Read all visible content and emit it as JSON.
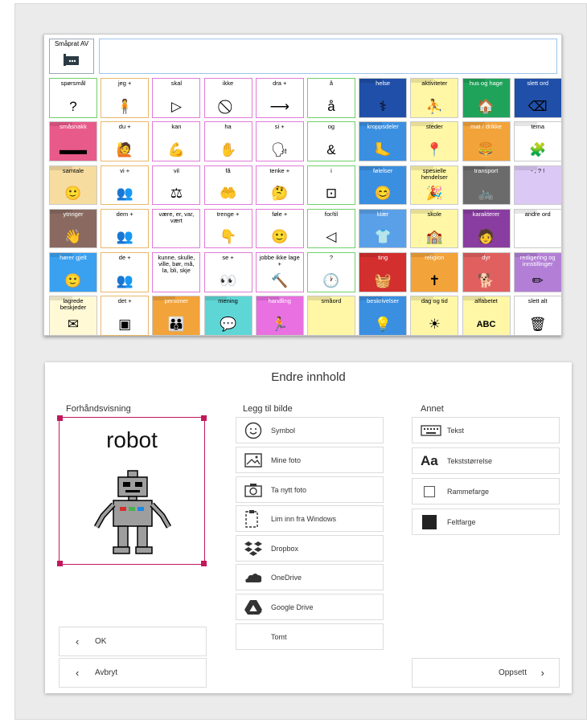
{
  "top_control": {
    "label": "Småprat AV",
    "icon": "speech-bubble-icon"
  },
  "message_bar": {
    "text": ""
  },
  "grid": [
    [
      {
        "label": "spørsmål",
        "glyph": "?",
        "bg": "#ffffff",
        "style": "gr",
        "folder": false
      },
      {
        "label": "jeg +",
        "glyph": "🧍",
        "bg": "#ffffff",
        "style": "yw",
        "folder": false
      },
      {
        "label": "skal",
        "glyph": "▷",
        "bg": "#ffffff",
        "style": "vb",
        "folder": false
      },
      {
        "label": "ikke",
        "glyph": "⃠",
        "bg": "#ffffff",
        "style": "vb",
        "folder": false
      },
      {
        "label": "dra +",
        "glyph": "⟶",
        "bg": "#ffffff",
        "style": "vb",
        "folder": false
      },
      {
        "label": "å",
        "glyph": "å",
        "bg": "#ffffff",
        "style": "gr",
        "folder": false
      },
      {
        "label": "helse",
        "glyph": "⚕",
        "bg": "#1f4fa8",
        "style": "",
        "folder": true
      },
      {
        "label": "aktiviteter",
        "glyph": "⛹",
        "bg": "#fff7a6",
        "style": "",
        "folder": true
      },
      {
        "label": "hus og hage",
        "glyph": "🏠",
        "bg": "#1fa35a",
        "style": "",
        "folder": true
      },
      {
        "label": "slett ord",
        "glyph": "⌫",
        "bg": "#1f4fa8",
        "style": "",
        "folder": false
      }
    ],
    [
      {
        "label": "småsnakk",
        "glyph": "▬▬",
        "bg": "#e85a8a",
        "style": "",
        "folder": true
      },
      {
        "label": "du +",
        "glyph": "🙋",
        "bg": "#ffffff",
        "style": "yw",
        "folder": false
      },
      {
        "label": "kan",
        "glyph": "💪",
        "bg": "#ffffff",
        "style": "vb",
        "folder": false
      },
      {
        "label": "ha",
        "glyph": "✋",
        "bg": "#ffffff",
        "style": "vb",
        "folder": false
      },
      {
        "label": "si +",
        "glyph": "🗣",
        "bg": "#ffffff",
        "style": "vb",
        "folder": false
      },
      {
        "label": "og",
        "glyph": "&",
        "bg": "#ffffff",
        "style": "gr",
        "folder": false
      },
      {
        "label": "kroppsdeler",
        "glyph": "🦶",
        "bg": "#3b8fe0",
        "style": "",
        "folder": true
      },
      {
        "label": "steder",
        "glyph": "📍",
        "bg": "#fff7a6",
        "style": "",
        "folder": true
      },
      {
        "label": "mat / drikke",
        "glyph": "🍔",
        "bg": "#f2a33a",
        "style": "",
        "folder": true
      },
      {
        "label": "tema",
        "glyph": "🧩",
        "bg": "#ffffff",
        "style": "",
        "folder": true
      }
    ],
    [
      {
        "label": "samtale",
        "glyph": "🙂",
        "bg": "#f7dca0",
        "style": "",
        "folder": true
      },
      {
        "label": "vi +",
        "glyph": "👥",
        "bg": "#ffffff",
        "style": "yw",
        "folder": false
      },
      {
        "label": "vil",
        "glyph": "⚖",
        "bg": "#ffffff",
        "style": "vb",
        "folder": false
      },
      {
        "label": "få",
        "glyph": "🤲",
        "bg": "#ffffff",
        "style": "vb",
        "folder": false
      },
      {
        "label": "tenke +",
        "glyph": "🤔",
        "bg": "#ffffff",
        "style": "vb",
        "folder": false
      },
      {
        "label": "i",
        "glyph": "⊡",
        "bg": "#ffffff",
        "style": "gr",
        "folder": false
      },
      {
        "label": "følelser",
        "glyph": "😊",
        "bg": "#3b8fe0",
        "style": "",
        "folder": true
      },
      {
        "label": "spesielle hendelser",
        "glyph": "🎉",
        "bg": "#fff7a6",
        "style": "",
        "folder": true
      },
      {
        "label": "transport",
        "glyph": "🚲",
        "bg": "#6b6b6b",
        "style": "",
        "folder": true
      },
      {
        "label": "- , ? !",
        "glyph": "",
        "bg": "#dcc8f5",
        "style": "",
        "folder": true
      }
    ],
    [
      {
        "label": "ytringer",
        "glyph": "👋",
        "bg": "#8a6a60",
        "style": "",
        "folder": true
      },
      {
        "label": "dem +",
        "glyph": "👥",
        "bg": "#ffffff",
        "style": "yw",
        "folder": false
      },
      {
        "label": "være, er, var, vært",
        "glyph": "",
        "bg": "#ffffff",
        "style": "vb",
        "folder": false
      },
      {
        "label": "trenge +",
        "glyph": "👇",
        "bg": "#ffffff",
        "style": "vb",
        "folder": false
      },
      {
        "label": "føle +",
        "glyph": "🙂",
        "bg": "#ffffff",
        "style": "vb",
        "folder": false
      },
      {
        "label": "for/til",
        "glyph": "◁",
        "bg": "#ffffff",
        "style": "gr",
        "folder": false
      },
      {
        "label": "klær",
        "glyph": "👕",
        "bg": "#5aa0e8",
        "style": "",
        "folder": true
      },
      {
        "label": "skole",
        "glyph": "🏫",
        "bg": "#fff7a6",
        "style": "",
        "folder": true
      },
      {
        "label": "karakterer",
        "glyph": "🧑",
        "bg": "#8a3da0",
        "style": "",
        "folder": true
      },
      {
        "label": "andre ord",
        "glyph": "",
        "bg": "#ffffff",
        "style": "",
        "folder": true
      }
    ],
    [
      {
        "label": "hører gjelt",
        "glyph": "🙂",
        "bg": "#3aa0f0",
        "style": "",
        "folder": true
      },
      {
        "label": "de +",
        "glyph": "👥",
        "bg": "#ffffff",
        "style": "yw",
        "folder": false
      },
      {
        "label": "kunne, skulle, ville, bør, må, la, bli, skje",
        "glyph": "",
        "bg": "#ffffff",
        "style": "vb",
        "folder": false
      },
      {
        "label": "se +",
        "glyph": "👀",
        "bg": "#ffffff",
        "style": "vb",
        "folder": false
      },
      {
        "label": "jobbe ikke lage +",
        "glyph": "🔨",
        "bg": "#ffffff",
        "style": "vb",
        "folder": false
      },
      {
        "label": "?",
        "glyph": "🕐",
        "bg": "#ffffff",
        "style": "gr",
        "folder": false
      },
      {
        "label": "ting",
        "glyph": "🧺",
        "bg": "#d32f2f",
        "style": "",
        "folder": true
      },
      {
        "label": "religion",
        "glyph": "✝",
        "bg": "#f2a33a",
        "style": "",
        "folder": true
      },
      {
        "label": "dyr",
        "glyph": "🐕",
        "bg": "#e06060",
        "style": "",
        "folder": true
      },
      {
        "label": "redigering og innstillinger",
        "glyph": "✏",
        "bg": "#b37fd6",
        "style": "",
        "folder": true
      }
    ],
    [
      {
        "label": "lagrede beskjeder",
        "glyph": "✉",
        "bg": "#fff9d6",
        "style": "",
        "folder": true
      },
      {
        "label": "det +",
        "glyph": "▣",
        "bg": "#ffffff",
        "style": "yw",
        "folder": false
      },
      {
        "label": "personer",
        "glyph": "👪",
        "bg": "#f2a33a",
        "style": "",
        "folder": true
      },
      {
        "label": "mening",
        "glyph": "💬",
        "bg": "#5fd6d6",
        "style": "",
        "folder": true
      },
      {
        "label": "handling",
        "glyph": "🏃",
        "bg": "#e870e0",
        "style": "",
        "folder": true
      },
      {
        "label": "småord",
        "glyph": "",
        "bg": "#fff7a6",
        "style": "",
        "folder": true
      },
      {
        "label": "beskrivelser",
        "glyph": "💡",
        "bg": "#3b8fe0",
        "style": "",
        "folder": true
      },
      {
        "label": "dag og tid",
        "glyph": "☀",
        "bg": "#fff7a6",
        "style": "",
        "folder": true
      },
      {
        "label": "alfabetet",
        "glyph": "ABC",
        "bg": "#fff7a6",
        "style": "",
        "folder": true
      },
      {
        "label": "slett alt",
        "glyph": "🗑",
        "bg": "#ffffff",
        "style": "",
        "folder": false
      }
    ]
  ],
  "panel": {
    "title": "Endre innhold",
    "preview_heading": "Forhåndsvisning",
    "preview_word": "robot",
    "image_heading": "Legg til bilde",
    "other_heading": "Annet",
    "image_buttons": [
      "Symbol",
      "Mine foto",
      "Ta nytt foto",
      "Lim inn fra Windows",
      "Dropbox",
      "OneDrive",
      "Google Drive",
      "Tomt"
    ],
    "other_buttons": [
      "Tekst",
      "Tekststørrelse",
      "Rammefarge",
      "Feltfarge"
    ],
    "ok_label": "OK",
    "cancel_label": "Avbryt",
    "setup_label": "Oppsett"
  }
}
